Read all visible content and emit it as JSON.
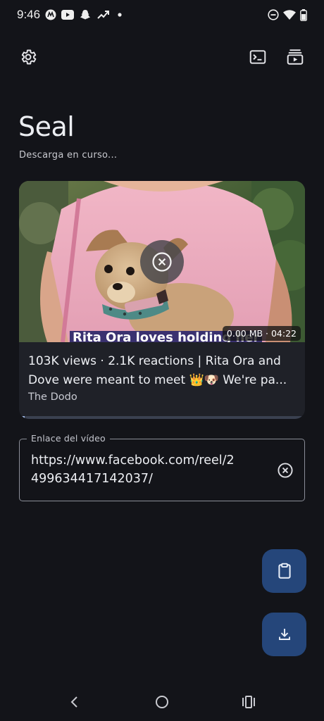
{
  "status_bar": {
    "time": "9:46",
    "left_icons": [
      "motorola-icon",
      "youtube-icon",
      "snapchat-icon",
      "trend-icon",
      "dot-icon"
    ],
    "right_icons": [
      "do-not-disturb-icon",
      "wifi-icon",
      "battery-icon"
    ]
  },
  "app_bar": {
    "icons": [
      "settings-icon",
      "terminal-icon",
      "playlist-icon"
    ]
  },
  "header": {
    "title": "Seal",
    "subtitle": "Descarga en curso..."
  },
  "video_card": {
    "thumbnail_caption": "Rita Ora loves holding her",
    "size_and_duration": "0.00 MB · 04:22",
    "title": "103K views · 2.1K reactions | Rita Ora and Dove were meant to meet 👑🐶 We're pa...",
    "channel": "The Dodo",
    "progress": 0.02,
    "cancel_icon": "cancel-icon"
  },
  "url_field": {
    "label": "Enlace del vídeo",
    "value": "https://www.facebook.com/reel/2499634417142037/",
    "clear_icon": "clear-icon"
  },
  "fabs": {
    "paste_icon": "clipboard-icon",
    "download_icon": "download-icon"
  },
  "nav_bar": {
    "icons": [
      "back-icon",
      "home-icon",
      "recents-icon"
    ]
  },
  "colors": {
    "background": "#131419",
    "card": "#1f2128",
    "fab": "#25467a",
    "progress": "#9fb8e6"
  }
}
